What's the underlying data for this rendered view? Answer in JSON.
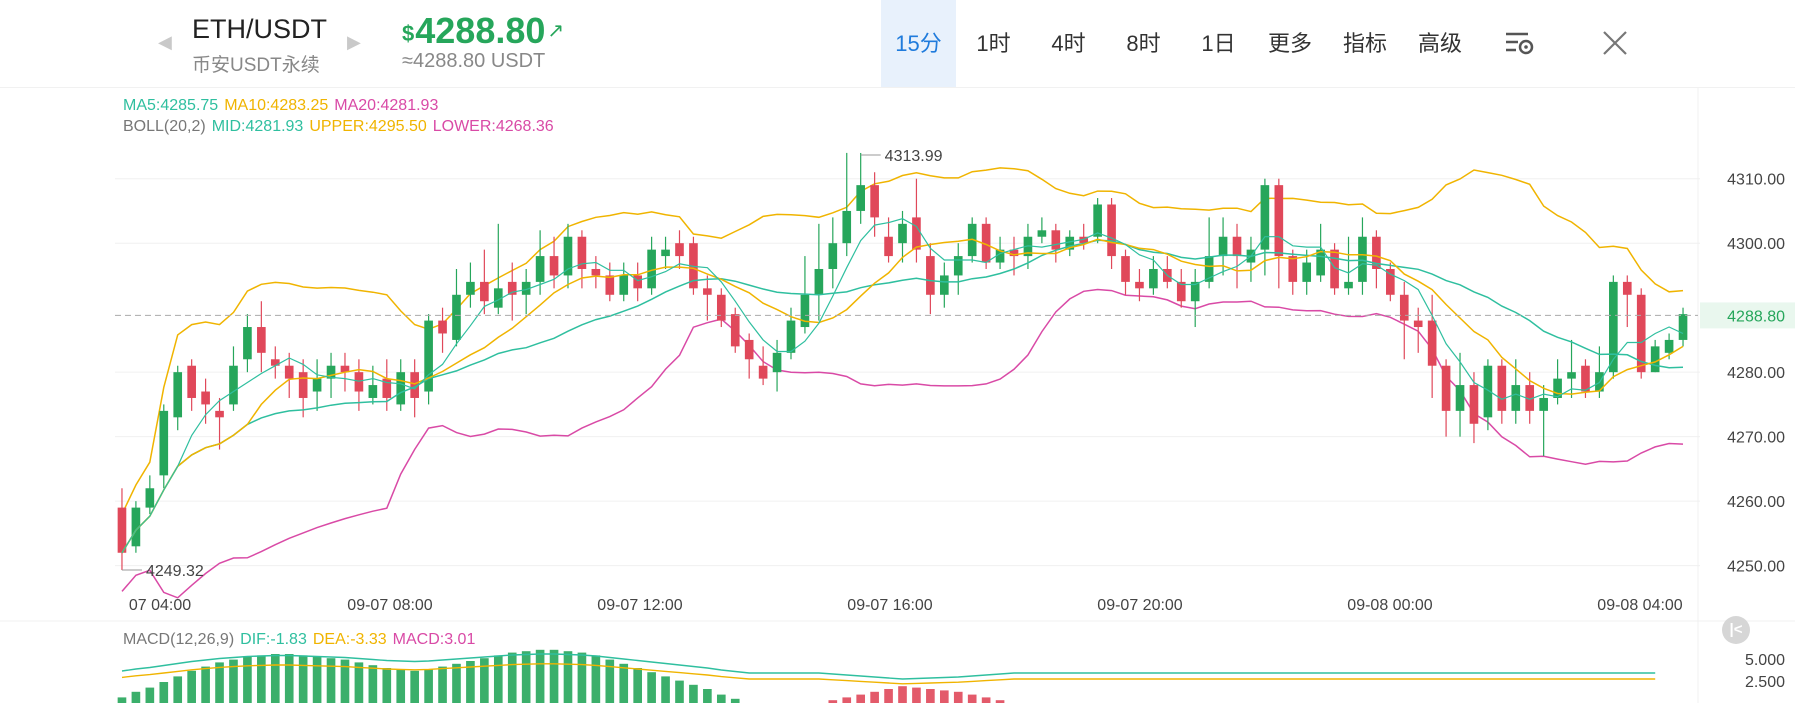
{
  "header": {
    "symbol": "ETH/USDT",
    "subtitle": "币安USDT永续",
    "price_symbol": "$",
    "price": "4288.80",
    "trend_icon": "↗",
    "approx": "≈4288.80 USDT",
    "prev_icon": "◀",
    "next_icon": "▶"
  },
  "tabs": [
    {
      "label": "15分",
      "active": true
    },
    {
      "label": "1时"
    },
    {
      "label": "4时"
    },
    {
      "label": "8时"
    },
    {
      "label": "1日"
    },
    {
      "label": "更多",
      "menu": true
    },
    {
      "label": "指标",
      "menu": true
    },
    {
      "label": "高级",
      "menu": true
    }
  ],
  "legend": {
    "ma": [
      {
        "label": "MA5:4285.75",
        "color": "#2fbf9f"
      },
      {
        "label": "MA10:4283.25",
        "color": "#f0b400"
      },
      {
        "label": "MA20:4281.93",
        "color": "#d94aa6"
      }
    ],
    "boll_title": "BOLL(20,2)",
    "boll": [
      {
        "label": "MID:4281.93",
        "color": "#2fbf9f"
      },
      {
        "label": "UPPER:4295.50",
        "color": "#f0b400"
      },
      {
        "label": "LOWER:4268.36",
        "color": "#d94aa6"
      }
    ],
    "macd_title": "MACD(12,26,9)",
    "macd": [
      {
        "label": "DIF:-1.83",
        "color": "#2fbf9f"
      },
      {
        "label": "DEA:-3.33",
        "color": "#f0b400"
      },
      {
        "label": "MACD:3.01",
        "color": "#d94aa6"
      }
    ]
  },
  "colors": {
    "up": "#26a65b",
    "down": "#e0485a",
    "accent": "#1f7bdc",
    "current_price": "#26a65b"
  },
  "icons": {
    "settings": "chart-settings-icon",
    "close": "close-icon",
    "collapse": "collapse-left-icon"
  },
  "chart_data": {
    "type": "candlestick",
    "interval": "15分",
    "y_axis": {
      "ticks": [
        "4310.00",
        "4300.00",
        "4280.00",
        "4270.00",
        "4260.00",
        "4250.00"
      ],
      "range": [
        4247,
        4316
      ]
    },
    "x_axis": {
      "ticks": [
        "07 04:00",
        "09-07 08:00",
        "09-07 12:00",
        "09-07 16:00",
        "09-07 20:00",
        "09-08 00:00",
        "09-08 04:00"
      ]
    },
    "current_price": "4288.80",
    "high_label": "4313.99",
    "low_label": "4249.32",
    "candles": [
      [
        4259,
        4252,
        4262,
        4249.32
      ],
      [
        4253,
        4259,
        4260,
        4252
      ],
      [
        4259,
        4262,
        4264,
        4258
      ],
      [
        4264,
        4274,
        4275,
        4262
      ],
      [
        4273,
        4280,
        4281,
        4271
      ],
      [
        4281,
        4276,
        4282,
        4274
      ],
      [
        4277,
        4275,
        4279,
        4272
      ],
      [
        4274,
        4273,
        4276,
        4268
      ],
      [
        4275,
        4281,
        4284,
        4274
      ],
      [
        4282,
        4287,
        4289,
        4280
      ],
      [
        4287,
        4283,
        4291,
        4280
      ],
      [
        4282,
        4281,
        4284,
        4279
      ],
      [
        4281,
        4279,
        4283,
        4276
      ],
      [
        4280,
        4276,
        4282,
        4273
      ],
      [
        4277,
        4279,
        4282,
        4274
      ],
      [
        4279,
        4281,
        4283,
        4276
      ],
      [
        4281,
        4280,
        4283,
        4277
      ],
      [
        4280,
        4277,
        4282,
        4274
      ],
      [
        4276,
        4278,
        4281,
        4275
      ],
      [
        4279,
        4276,
        4282,
        4274
      ],
      [
        4275,
        4280,
        4282,
        4274
      ],
      [
        4280,
        4276,
        4282,
        4273
      ],
      [
        4277,
        4288,
        4289,
        4275
      ],
      [
        4288,
        4286,
        4290,
        4283
      ],
      [
        4285,
        4292,
        4296,
        4284
      ],
      [
        4292,
        4294,
        4297,
        4290
      ],
      [
        4294,
        4291,
        4299,
        4289
      ],
      [
        4290,
        4293,
        4303,
        4289
      ],
      [
        4294,
        4292,
        4297,
        4288
      ],
      [
        4292,
        4294,
        4296,
        4289
      ],
      [
        4294,
        4298,
        4302,
        4292
      ],
      [
        4298,
        4295,
        4301,
        4293
      ],
      [
        4295,
        4301,
        4303,
        4293
      ],
      [
        4301,
        4296,
        4302,
        4293
      ],
      [
        4296,
        4295,
        4298,
        4293
      ],
      [
        4295,
        4292,
        4297,
        4291
      ],
      [
        4292,
        4295,
        4297,
        4291
      ],
      [
        4295,
        4293,
        4297,
        4291
      ],
      [
        4293,
        4299,
        4301,
        4292
      ],
      [
        4298,
        4299,
        4301,
        4296
      ],
      [
        4300,
        4298,
        4302,
        4296
      ],
      [
        4300,
        4293,
        4301,
        4292
      ],
      [
        4293,
        4292,
        4295,
        4288
      ],
      [
        4292,
        4288,
        4293,
        4287
      ],
      [
        4289,
        4284,
        4290,
        4283
      ],
      [
        4285,
        4282,
        4286,
        4279
      ],
      [
        4281,
        4279,
        4284,
        4278
      ],
      [
        4280,
        4283,
        4285,
        4277
      ],
      [
        4283,
        4288,
        4290,
        4282
      ],
      [
        4287,
        4292,
        4298,
        4286
      ],
      [
        4292,
        4296,
        4303,
        4288
      ],
      [
        4296,
        4300,
        4304,
        4293
      ],
      [
        4300,
        4305,
        4314,
        4298
      ],
      [
        4305,
        4309,
        4313.99,
        4303
      ],
      [
        4309,
        4304,
        4311,
        4301
      ],
      [
        4301,
        4298,
        4304,
        4297
      ],
      [
        4300,
        4303,
        4305,
        4297
      ],
      [
        4304,
        4299,
        4310,
        4297
      ],
      [
        4298,
        4292,
        4300,
        4289
      ],
      [
        4292,
        4295,
        4297,
        4290
      ],
      [
        4295,
        4298,
        4300,
        4292
      ],
      [
        4298,
        4303,
        4304,
        4297
      ],
      [
        4303,
        4297,
        4304,
        4296
      ],
      [
        4297,
        4299,
        4301,
        4296
      ],
      [
        4299,
        4298,
        4301,
        4295
      ],
      [
        4298,
        4301,
        4303,
        4296
      ],
      [
        4301,
        4302,
        4304,
        4300
      ],
      [
        4302,
        4299,
        4303,
        4297
      ],
      [
        4299,
        4301,
        4302,
        4298
      ],
      [
        4301,
        4300,
        4303,
        4299
      ],
      [
        4301,
        4306,
        4307,
        4300
      ],
      [
        4306,
        4298,
        4307,
        4296
      ],
      [
        4298,
        4294,
        4299,
        4292
      ],
      [
        4294,
        4293,
        4296,
        4291
      ],
      [
        4293,
        4296,
        4298,
        4292
      ],
      [
        4296,
        4294,
        4298,
        4293
      ],
      [
        4294,
        4291,
        4296,
        4290
      ],
      [
        4291,
        4294,
        4296,
        4287
      ],
      [
        4294,
        4298,
        4304,
        4293
      ],
      [
        4298,
        4301,
        4304,
        4295
      ],
      [
        4301,
        4298,
        4303,
        4293
      ],
      [
        4297,
        4299,
        4301,
        4294
      ],
      [
        4299,
        4309,
        4310,
        4295
      ],
      [
        4309,
        4298,
        4310,
        4293
      ],
      [
        4298,
        4294,
        4299,
        4292
      ],
      [
        4294,
        4297,
        4299,
        4292
      ],
      [
        4295,
        4299,
        4303,
        4294
      ],
      [
        4299,
        4293,
        4300,
        4292
      ],
      [
        4293,
        4294,
        4301,
        4292
      ],
      [
        4294,
        4301,
        4304,
        4292
      ],
      [
        4301,
        4296,
        4302,
        4293
      ],
      [
        4296,
        4292,
        4297,
        4291
      ],
      [
        4292,
        4288,
        4294,
        4282
      ],
      [
        4288,
        4287,
        4290,
        4283
      ],
      [
        4288,
        4281,
        4292,
        4276
      ],
      [
        4281,
        4274,
        4282,
        4270
      ],
      [
        4274,
        4278,
        4283,
        4270
      ],
      [
        4278,
        4272,
        4280,
        4269
      ],
      [
        4273,
        4281,
        4282,
        4271
      ],
      [
        4281,
        4274,
        4282,
        4272
      ],
      [
        4274,
        4278,
        4282,
        4272
      ],
      [
        4278,
        4274,
        4280,
        4272
      ],
      [
        4274,
        4276,
        4278,
        4267
      ],
      [
        4276,
        4279,
        4282,
        4275
      ],
      [
        4279,
        4280,
        4285,
        4276
      ],
      [
        4281,
        4277,
        4282,
        4276
      ],
      [
        4277,
        4280,
        4284,
        4276
      ],
      [
        4280,
        4294,
        4295,
        4279
      ],
      [
        4294,
        4292,
        4295,
        4287
      ],
      [
        4292,
        4280,
        4293,
        4279
      ],
      [
        4280,
        4284,
        4285,
        4280
      ],
      [
        4283,
        4285,
        4286,
        4282
      ],
      [
        4285,
        4289,
        4290,
        4284
      ]
    ],
    "macd_hist": [
      0.4,
      0.8,
      1.1,
      1.5,
      1.9,
      2.3,
      2.6,
      2.9,
      3.1,
      3.3,
      3.4,
      3.5,
      3.5,
      3.4,
      3.3,
      3.2,
      3.1,
      2.9,
      2.7,
      2.5,
      2.4,
      2.3,
      2.4,
      2.6,
      2.8,
      3.0,
      3.2,
      3.4,
      3.6,
      3.7,
      3.8,
      3.8,
      3.7,
      3.6,
      3.4,
      3.1,
      2.8,
      2.5,
      2.2,
      1.9,
      1.6,
      1.3,
      1.0,
      0.6,
      0.3,
      0,
      0,
      0,
      0,
      0,
      0,
      -0.2,
      -0.4,
      -0.6,
      -0.8,
      -1.0,
      -1.2,
      -1.1,
      -1.0,
      -0.9,
      -0.8,
      -0.6,
      -0.4,
      -0.2,
      0,
      0,
      0,
      0,
      0,
      0,
      0,
      0,
      0,
      0,
      0,
      0,
      0,
      0,
      0,
      0,
      0,
      0,
      0,
      0,
      0,
      0,
      0,
      0,
      0,
      0,
      0,
      0,
      0,
      0,
      0,
      0,
      0,
      0,
      0,
      0,
      0,
      0,
      0,
      0,
      0,
      0,
      0,
      0,
      0,
      0,
      0
    ],
    "macd_ticks": [
      "5.000",
      "2.500"
    ]
  }
}
